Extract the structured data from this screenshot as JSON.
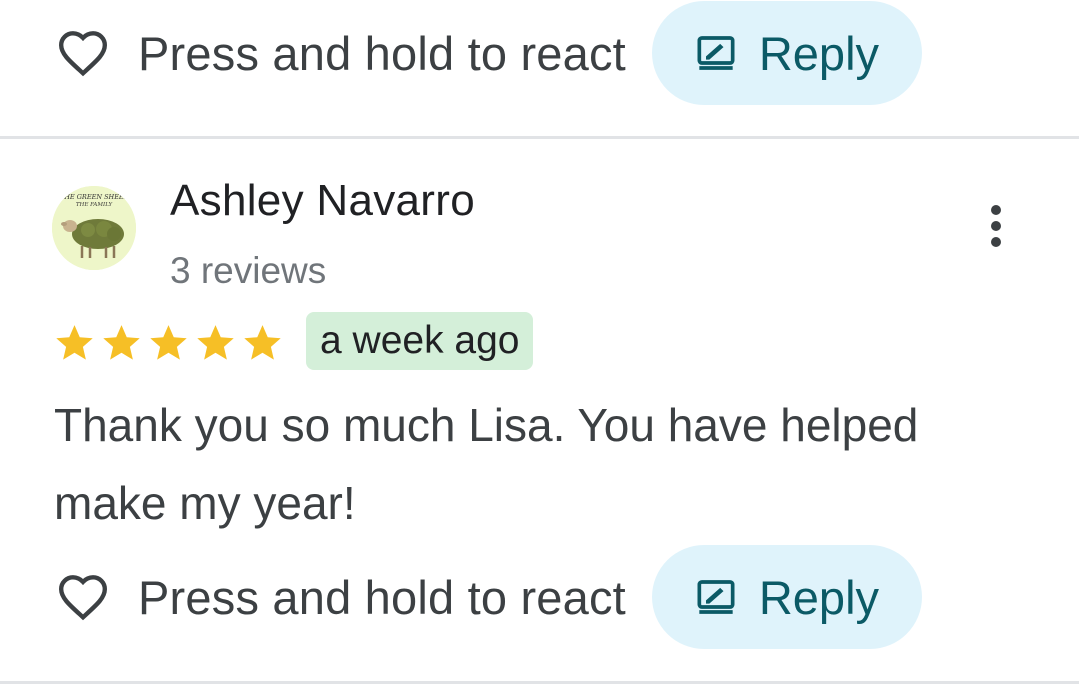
{
  "top_actions": {
    "react_label": "Press and hold to react",
    "reply_label": "Reply"
  },
  "review": {
    "author": {
      "name": "Ashley Navarro",
      "review_count": "3 reviews",
      "avatar_icon": "green-sheep-avatar",
      "avatar_text_line1": "THE GREEN SHEEP",
      "avatar_text_line2": "THE FAMILY"
    },
    "rating": 5,
    "date": "a week ago",
    "text": "Thank you so much Lisa. You have helped make my year!",
    "react_label": "Press and hold to react",
    "reply_label": "Reply"
  },
  "colors": {
    "star": "#f6bf26",
    "reply_bg": "#dff3fb",
    "reply_text": "#0b5a66",
    "date_badge_bg": "#d4efd9"
  },
  "icons": [
    "heart-icon",
    "reply-icon",
    "more-vert-icon",
    "star-icon"
  ]
}
